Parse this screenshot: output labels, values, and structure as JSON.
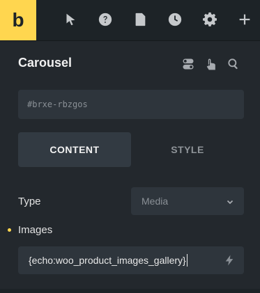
{
  "toolbar": {
    "logo_letter": "b",
    "icons": [
      "pointer-icon",
      "help-icon",
      "pages-icon",
      "history-icon",
      "settings-icon",
      "add-icon"
    ]
  },
  "panel": {
    "title": "Carousel",
    "header_icons": [
      "toggle-icon",
      "interaction-icon",
      "search-icon"
    ],
    "css_id_placeholder": "#brxe-rbzgos"
  },
  "tabs": [
    {
      "label": "CONTENT",
      "active": true
    },
    {
      "label": "STYLE",
      "active": false
    }
  ],
  "controls": {
    "type_label": "Type",
    "type_value": "Media",
    "images_label": "Images",
    "images_value": "{echo:woo_product_images_gallery}"
  },
  "colors": {
    "accent": "#ffd64f",
    "background": "#23282d",
    "input_bg": "#2e353c"
  }
}
